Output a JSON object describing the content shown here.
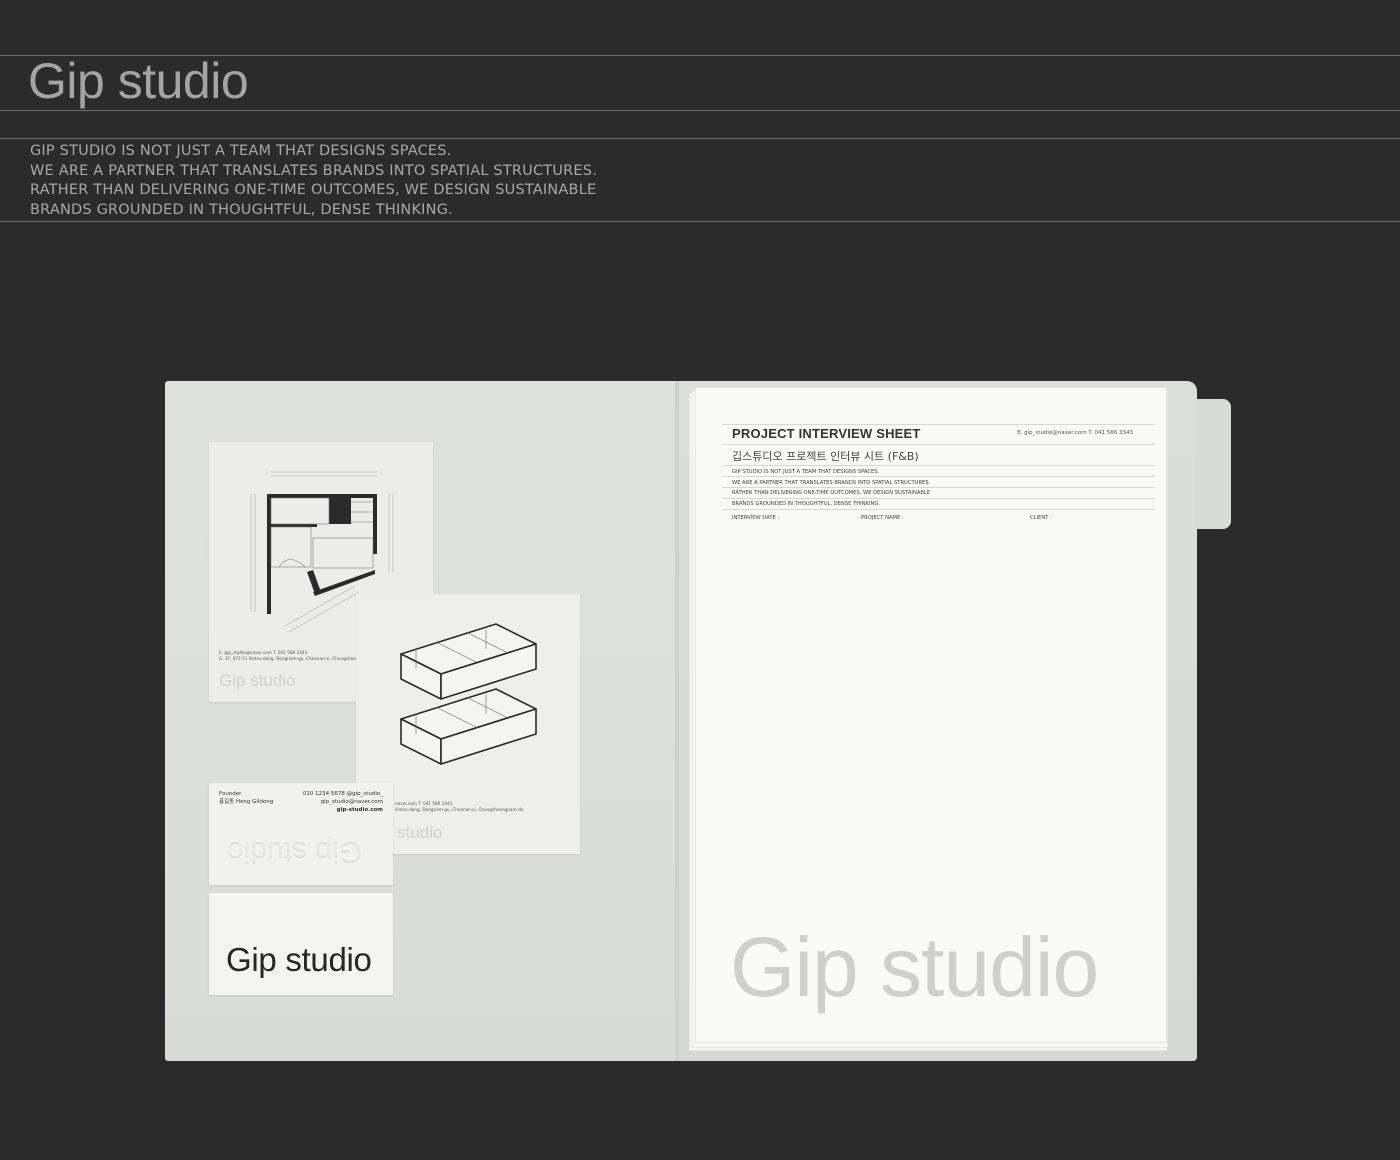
{
  "header": {
    "brand_title": "Gip studio",
    "tagline_lines": [
      "GIP STUDIO IS NOT JUST A TEAM THAT DESIGNS SPACES.",
      "WE ARE A PARTNER THAT TRANSLATES BRANDS INTO SPATIAL STRUCTURES.",
      "RATHER THAN DELIVERING ONE-TIME OUTCOMES, WE DESIGN SUSTAINABLE",
      "BRANDS GROUNDED IN THOUGHTFUL, DENSE THINKING."
    ]
  },
  "plan_sheet": {
    "contact": "E. gip_studio@naver.com   T. 041 566 3343",
    "address": "G. 3F, 472-11 Ilintsu-dong, Dongnam-gu, Cheonan-si, Chungcheongnam-do",
    "watermark": "Gip studio"
  },
  "iso_sheet": {
    "contact": "naver.com   T. 041 566 3343",
    "address": "ilintsu-dong, Dongnam-gu, Cheonan-si, Chungcheongnam-do",
    "watermark": "studio"
  },
  "business_card": {
    "role": "Founder",
    "name": "홍길동 Hong Gildong",
    "phone": "010 1234 5678  @gip_studio_",
    "email": "gip_studio@naver.com",
    "web": "gip-studio.com",
    "emboss": "Gip studio",
    "front_logo": "Gip studio"
  },
  "interview_sheet": {
    "title": "PROJECT INTERVIEW SHEET",
    "contact": "E. gip_studio@naver.com    T. 041 566 3343",
    "subtitle": "깁스튜디오 프로젝트 인터뷰 시트 (F&B)",
    "body_lines": [
      "GIP STUDIO IS NOT JUST A TEAM THAT DESIGNS SPACES.",
      "WE ARE A PARTNER THAT TRANSLATES BRANDS INTO SPATIAL STRUCTURES.",
      "RATHER THAN DELIVERING ONE-TIME OUTCOMES, WE DESIGN SUSTAINABLE",
      "BRANDS GROUNDED IN THOUGHTFUL, DENSE THINKING."
    ],
    "field_interview_date": "INTERVIEW DATE :",
    "field_project_name": "PROJECT NAME :",
    "field_client": "CLIENT :",
    "watermark": "Gip studio"
  },
  "colors": {
    "background": "#2b2b2b",
    "header_text": "#a4a4a4",
    "folder": "#dcdeda",
    "paper": "#fafaf7"
  },
  "icons": [
    "floor-plan-drawing",
    "isometric-model-drawing"
  ]
}
